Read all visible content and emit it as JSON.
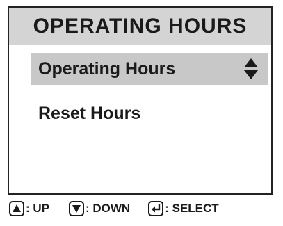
{
  "title": "OPERATING HOURS",
  "menu": {
    "items": [
      {
        "label": "Operating Hours",
        "selected": true,
        "icon": "up-down-arrows-icon"
      },
      {
        "label": "Reset Hours",
        "selected": false
      }
    ]
  },
  "footer": {
    "up": {
      "icon": "up-arrow-key-icon",
      "label": ": UP"
    },
    "down": {
      "icon": "down-arrow-key-icon",
      "label": ": DOWN"
    },
    "select": {
      "icon": "enter-key-icon",
      "label": ": SELECT"
    }
  },
  "colors": {
    "title_bar": "#d4d4d4",
    "selection": "#c8c8c8",
    "text": "#1a1a1a"
  }
}
